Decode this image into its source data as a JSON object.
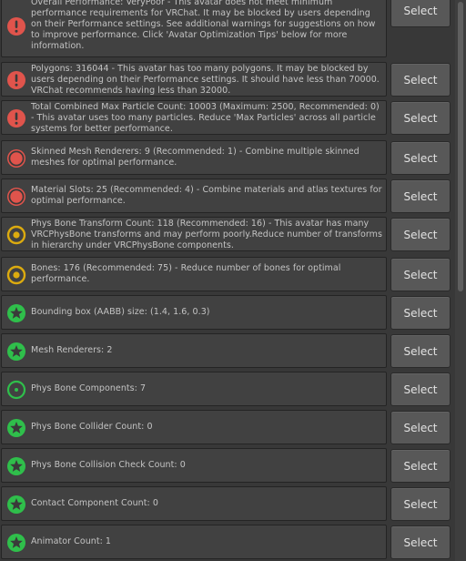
{
  "validation_list": {
    "select_label": "Select",
    "items": [
      {
        "severity": "error",
        "icon": "error-exclamation-icon",
        "text": "Overall Performance: VeryPoor - This avatar does not meet minimum performance requirements for VRChat. It may be blocked by users depending on their Performance settings. See additional warnings for suggestions on how to improve performance. Click 'Avatar Optimization Tips' below for more information."
      },
      {
        "severity": "error",
        "icon": "error-exclamation-icon",
        "text": "Polygons: 316044 - This avatar has too many polygons. It may be blocked by users depending on their Performance settings. It should have less than 70000. VRChat recommends having less than 32000."
      },
      {
        "severity": "error",
        "icon": "error-exclamation-icon",
        "text": "Total Combined Max Particle Count: 10003 (Maximum: 2500, Recommended: 0) - This avatar uses too many particles. Reduce 'Max Particles' across all particle systems for better performance."
      },
      {
        "severity": "poor",
        "icon": "red-circle-icon",
        "text": "Skinned Mesh Renderers: 9 (Recommended: 1) - Combine multiple skinned meshes for optimal performance."
      },
      {
        "severity": "poor",
        "icon": "red-circle-icon",
        "text": "Material Slots: 25 (Recommended: 4) - Combine materials and atlas textures for optimal performance."
      },
      {
        "severity": "medium",
        "icon": "yellow-ring-icon",
        "text": "Phys Bone Transform Count: 118 (Recommended: 16) - This avatar has many VRCPhysBone transforms and may perform poorly.Reduce number of transforms in hierarchy under VRCPhysBone components."
      },
      {
        "severity": "medium",
        "icon": "yellow-ring-icon",
        "text": "Bones: 176 (Recommended: 75) - Reduce number of bones for optimal performance."
      },
      {
        "severity": "excellent",
        "icon": "green-star-icon",
        "text": "Bounding box (AABB) size: (1.4, 1.6, 0.3)"
      },
      {
        "severity": "excellent",
        "icon": "green-star-icon",
        "text": "Mesh Renderers: 2"
      },
      {
        "severity": "good",
        "icon": "green-ring-icon",
        "text": "Phys Bone Components: 7"
      },
      {
        "severity": "excellent",
        "icon": "green-star-icon",
        "text": "Phys Bone Collider Count: 0"
      },
      {
        "severity": "excellent",
        "icon": "green-star-icon",
        "text": "Phys Bone Collision Check Count: 0"
      },
      {
        "severity": "excellent",
        "icon": "green-star-icon",
        "text": "Contact Component Count: 0"
      },
      {
        "severity": "excellent",
        "icon": "green-star-icon",
        "text": "Animator Count: 1"
      }
    ]
  },
  "colors": {
    "error": "#e0544c",
    "poor": "#e0544c",
    "medium": "#dcab0f",
    "good": "#2fbf4b",
    "excellent": "#2fbf4b"
  }
}
